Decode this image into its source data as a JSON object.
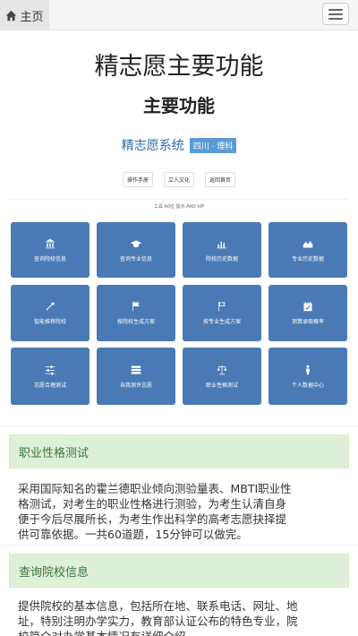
{
  "nav": {
    "home_label": "主页"
  },
  "page_title": "精志愿主要功能",
  "section_title": "主要功能",
  "app": {
    "name": "精志愿系统",
    "badge": "四川 · 理科",
    "subtitle": "",
    "links": [
      "操作手册",
      "立人文化",
      "返回首页"
    ],
    "status": "工具  A0位  提示  A4D  VIP"
  },
  "features": [
    {
      "icon": "bank-icon",
      "label": "查询院校信息"
    },
    {
      "icon": "graduation-cap-icon",
      "label": "查询专业信息"
    },
    {
      "icon": "bar-chart-icon",
      "label": "院校历史数据"
    },
    {
      "icon": "area-chart-icon",
      "label": "专业历史数据"
    },
    {
      "icon": "magic-wand-icon",
      "label": "智能推荐院校"
    },
    {
      "icon": "flag-icon",
      "label": "按院校生成方案"
    },
    {
      "icon": "flag-outline-icon",
      "label": "按专业生成方案"
    },
    {
      "icon": "calendar-check-icon",
      "label": "测算录取概率"
    },
    {
      "icon": "sliders-icon",
      "label": "志愿合理测试"
    },
    {
      "icon": "server-icon",
      "label": "自我测评志愿"
    },
    {
      "icon": "balance-scale-icon",
      "label": "职业性格测试"
    },
    {
      "icon": "user-icon",
      "label": "个人数据中心"
    }
  ],
  "cards": [
    {
      "title": "职业性格测试",
      "lines": [
        "采用国际知名的霍兰德职业倾向测验量表、MBTI职业性",
        "格测试，对考生的职业性格进行测验，为考生认清自身",
        "便于今后尽展所长，为考生作出科学的高考志愿抉择提",
        "供可靠依据。一共60道题，15分钟可以做完。"
      ]
    },
    {
      "title": "查询院校信息",
      "lines": [
        "提供院校的基本信息，包括所在地、联系电话、网址、地",
        "址，特别注明办学实力，教育部认证公布的特色专业，院",
        "校简介对办学基本情况有详细介绍。"
      ]
    }
  ],
  "colors": {
    "tile": "#4a7ab5",
    "card_head_bg": "#dff0d8",
    "card_head_text": "#3c763d"
  }
}
